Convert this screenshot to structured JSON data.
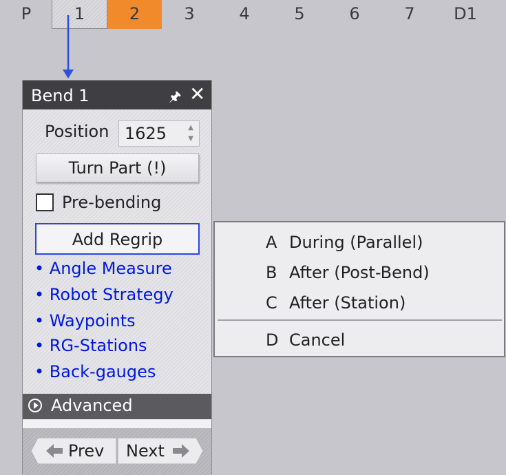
{
  "tabs": [
    "P",
    "1",
    "2",
    "3",
    "4",
    "5",
    "6",
    "7",
    "D1"
  ],
  "colors": {
    "active_tab": "#f08a2a",
    "arrow": "#2f4fe0",
    "link": "#0018e0",
    "titlebar": "#3f3f42"
  },
  "panel": {
    "title": "Bend 1",
    "pin_icon": "🖈",
    "close_icon": "✕",
    "position_label": "Position",
    "position_value": "1625",
    "turn_part": "Turn Part (!)",
    "prebending_label": "Pre-bending",
    "add_regrip": "Add Regrip",
    "links": [
      "• Angle Measure",
      "• Robot Strategy",
      "• Waypoints",
      "• RG-Stations",
      "• Back-gauges"
    ],
    "advanced": "Advanced",
    "prev": "Prev",
    "next": "Next"
  },
  "menu": {
    "items": [
      {
        "key": "A",
        "label": "During (Parallel)"
      },
      {
        "key": "B",
        "label": "After (Post-Bend)"
      },
      {
        "key": "C",
        "label": "After (Station)"
      },
      {
        "key": "D",
        "label": "Cancel"
      }
    ]
  }
}
